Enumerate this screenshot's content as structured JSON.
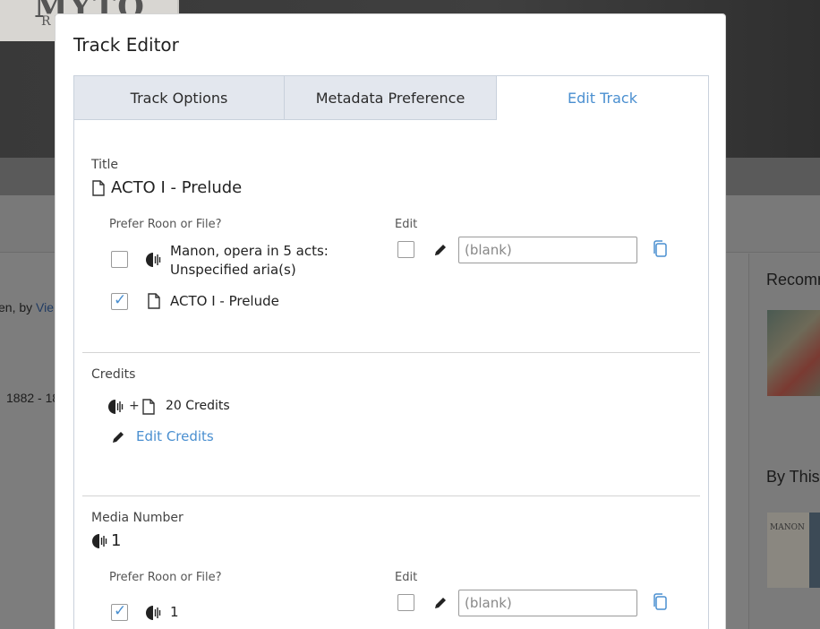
{
  "background": {
    "logo_text": "MYTO",
    "logo_sub": "R",
    "snippet_by": "en, by",
    "snippet_link": "Vie",
    "snippet_years": "1882 - 18",
    "right_heading_1": "Recomm",
    "right_heading_2": "By This",
    "thumb2_text": "MANON"
  },
  "modal": {
    "title": "Track Editor",
    "tabs": [
      {
        "label": "Track Options",
        "active": false
      },
      {
        "label": "Metadata Preference",
        "active": false
      },
      {
        "label": "Edit Track",
        "active": true
      }
    ]
  },
  "title_section": {
    "label": "Title",
    "current_value": "ACTO I - Prelude",
    "prefer_label": "Prefer Roon or File?",
    "edit_label": "Edit",
    "roon_option": {
      "text": "Manon, opera in 5 acts: Unspecified aria(s)",
      "checked": false
    },
    "file_option": {
      "text": "ACTO I - Prelude",
      "checked": true
    },
    "edit_checked": false,
    "edit_placeholder": "(blank)"
  },
  "credits_section": {
    "label": "Credits",
    "plus": "+",
    "count_text": "20 Credits",
    "edit_link": "Edit Credits"
  },
  "media_section": {
    "label": "Media Number",
    "current_value": "1",
    "prefer_label": "Prefer Roon or File?",
    "edit_label": "Edit",
    "roon_option": {
      "text": "1",
      "checked": true
    },
    "edit_checked": false,
    "edit_placeholder": "(blank)"
  },
  "icons": {
    "file": "file-icon",
    "roon": "roon-icon",
    "pencil": "pencil-icon",
    "copy": "copy-icon"
  },
  "colors": {
    "accent": "#4a8fd0",
    "tab_inactive_bg": "#e3e7ee",
    "overlay": "#777777"
  }
}
